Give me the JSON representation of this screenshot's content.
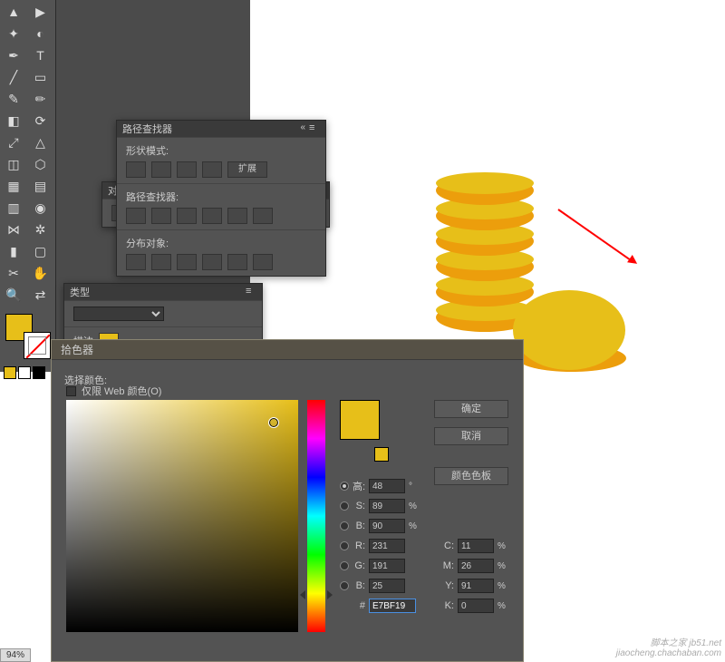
{
  "tools": {
    "items": [
      "selection-tool",
      "direct-selection-tool",
      "magic-wand-tool",
      "lasso-tool",
      "pen-tool",
      "type-tool",
      "line-tool",
      "rectangle-tool",
      "brush-tool",
      "pencil-tool",
      "eraser-tool",
      "rotate-tool",
      "scale-tool",
      "width-tool",
      "free-transform-tool",
      "shape-builder-tool",
      "perspective-grid-tool",
      "mesh-tool",
      "gradient-tool",
      "eyedropper-tool",
      "blend-tool",
      "symbol-sprayer-tool",
      "column-graph-tool",
      "artboard-tool",
      "slice-tool",
      "hand-tool",
      "zoom-tool",
      "fill-stroke-toggle"
    ],
    "glyphs": [
      "▲",
      "▶",
      "✦",
      "◐",
      "✒",
      "T",
      "╱",
      "▭",
      "✎",
      "✏",
      "◧",
      "⟳",
      "⤢",
      "△",
      "◫",
      "⬡",
      "▦",
      "▤",
      "▥",
      "◉",
      "⋈",
      "✲",
      "▮",
      "▢",
      "✂",
      "✋",
      "🔍",
      "⇄"
    ]
  },
  "swatches": {
    "fill": "#e7bf19",
    "mini": [
      "#e7bf19",
      "#ffffff",
      "#000000"
    ]
  },
  "pathfinder": {
    "title": "路径查找器",
    "shape_modes_label": "形状模式:",
    "expand_label": "扩展",
    "pathfinders_label": "路径查找器:",
    "align_label": "对齐",
    "distribute_label": "分布对象:"
  },
  "appearance": {
    "type_label": "类型",
    "stroke_label": "描边"
  },
  "picker": {
    "title": "拾色器",
    "select_label": "选择颜色:",
    "ok": "确定",
    "cancel": "取消",
    "swatch_panel": "颜色色板",
    "web_only": "仅限 Web 颜色(O)",
    "hsb": {
      "h_label": "高:",
      "s_label": "S:",
      "b_label": "B:",
      "h": "48",
      "s": "89",
      "b": "90"
    },
    "rgb": {
      "r_label": "R:",
      "g_label": "G:",
      "b_label": "B:",
      "r": "231",
      "g": "191",
      "b": "25"
    },
    "cmyk": {
      "c_label": "C:",
      "m_label": "M:",
      "y_label": "Y:",
      "k_label": "K:",
      "c": "11",
      "m": "26",
      "y": "91",
      "k": "0"
    },
    "hex_label": "#",
    "hex": "E7BF19",
    "deg_suffix": "°",
    "pct_suffix": "%",
    "preview_color": "#e7bf19"
  },
  "watermark": {
    "line1": "脚本之家 jb51.net",
    "line2": "jiaocheng.chachaban.com"
  },
  "zoom": "94%"
}
